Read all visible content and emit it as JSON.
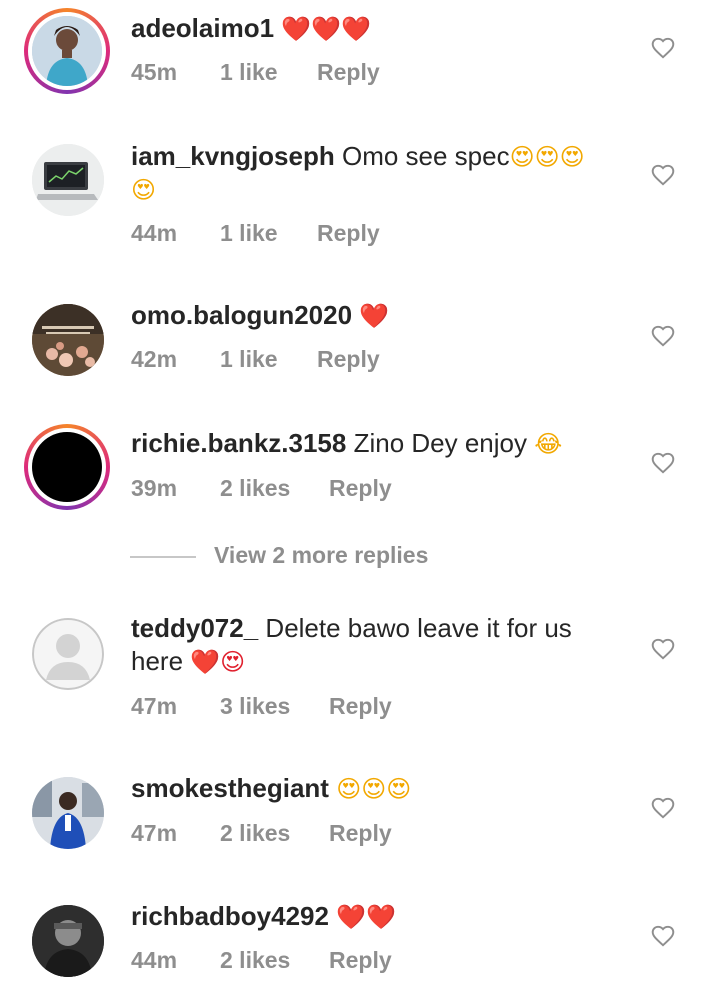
{
  "comments": [
    {
      "username": "adeolaimo1",
      "text": "",
      "emoji": "❤️❤️❤️",
      "time": "45m",
      "likes": "1 like",
      "reply": "Reply",
      "avatar": "woman-in-blue"
    },
    {
      "username": "iam_kvngjoseph",
      "text": "Omo see spec",
      "emoji": "😍😍😍",
      "emoji2": "😍",
      "time": "44m",
      "likes": "1 like",
      "reply": "Reply",
      "avatar": "laptop-chart"
    },
    {
      "username": "omo.balogun2020",
      "text": "",
      "emoji": "❤️",
      "time": "42m",
      "likes": "1 like",
      "reply": "Reply",
      "avatar": "flowers-text"
    },
    {
      "username": "richie.bankz.3158",
      "text": "Zino Dey enjoy",
      "emoji": "😂",
      "time": "39m",
      "likes": "2 likes",
      "reply": "Reply",
      "avatar": "black"
    },
    {
      "username": "teddy072_",
      "text": "Delete bawo leave it for us",
      "text2": "here",
      "emoji": "❤️😍",
      "time": "47m",
      "likes": "3 likes",
      "reply": "Reply",
      "avatar": "default"
    },
    {
      "username": "smokesthegiant",
      "text": "",
      "emoji": "😍😍😍",
      "time": "47m",
      "likes": "2 likes",
      "reply": "Reply",
      "avatar": "man-blue-suit"
    },
    {
      "username": "richbadboy4292",
      "text": "",
      "emoji": "❤️❤️",
      "time": "44m",
      "likes": "2 likes",
      "reply": "Reply",
      "avatar": "dark-portrait"
    }
  ],
  "view_replies": {
    "label": "View 2 more replies"
  },
  "colors": {
    "secondary_text": "#8e8e8e",
    "primary_text": "#262626",
    "heart": "#e0202e",
    "story_ring": "#dd2a7b"
  },
  "icons": {
    "like": "heart-outline-icon"
  }
}
